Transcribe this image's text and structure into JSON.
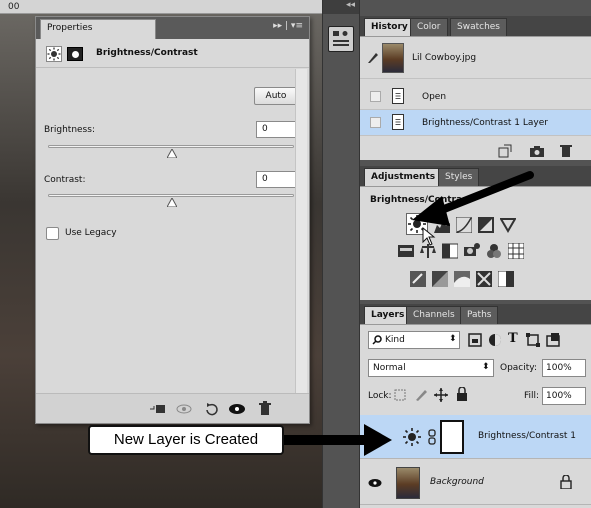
{
  "canvas": {
    "ruler_number": "00"
  },
  "properties": {
    "tab_label": "Properties",
    "menu_glyph": "▸▸ | ▾≡",
    "title": "Brightness/Contrast",
    "auto_label": "Auto",
    "brightness_label": "Brightness:",
    "brightness_value": "0",
    "contrast_label": "Contrast:",
    "contrast_value": "0",
    "legacy_label": "Use Legacy"
  },
  "dock": {
    "collapse_glyph": "◂◂"
  },
  "history": {
    "tabs": [
      "History",
      "Color",
      "Swatches"
    ],
    "snapshot_name": "Lil Cowboy.jpg",
    "items": [
      "Open",
      "Brightness/Contrast 1 Layer"
    ]
  },
  "adjustments": {
    "tabs": [
      "Adjustments",
      "Styles"
    ],
    "hover_label": "Brightness/Contrast"
  },
  "layers": {
    "tabs": [
      "Layers",
      "Channels",
      "Paths"
    ],
    "filter_kind": "Kind",
    "blend_mode": "Normal",
    "opacity_label": "Opacity:",
    "opacity_value": "100%",
    "lock_label": "Lock:",
    "fill_label": "Fill:",
    "fill_value": "100%",
    "rows": [
      {
        "name": "Brightness/Contrast 1",
        "italic": false,
        "selected": true
      },
      {
        "name": "Background",
        "italic": true,
        "selected": false
      }
    ]
  },
  "callout": {
    "text": "New Layer is Created"
  },
  "colors": {
    "selected_row": "#bcd7f5",
    "panel_bg": "#d9d9d9",
    "dark_ui": "#535353"
  }
}
